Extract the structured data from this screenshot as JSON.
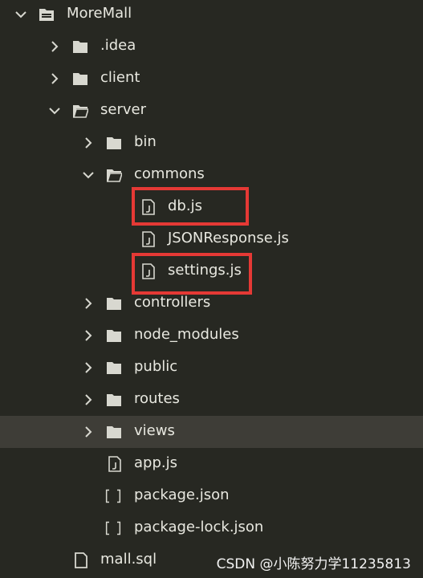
{
  "tree": {
    "root": {
      "label": "MoreMall",
      "icon": "open-folder-icon",
      "expanded": true
    },
    "items": [
      {
        "label": ".idea",
        "type": "folder",
        "expanded": false
      },
      {
        "label": "client",
        "type": "folder",
        "expanded": false
      },
      {
        "label": "server",
        "type": "folder",
        "expanded": true
      },
      {
        "label": "bin",
        "type": "folder",
        "expanded": false
      },
      {
        "label": "commons",
        "type": "folder",
        "expanded": true
      },
      {
        "label": "db.js",
        "type": "js-file",
        "highlighted": true
      },
      {
        "label": "JSONResponse.js",
        "type": "js-file"
      },
      {
        "label": "settings.js",
        "type": "js-file",
        "highlighted": true
      },
      {
        "label": "controllers",
        "type": "folder",
        "expanded": false
      },
      {
        "label": "node_modules",
        "type": "folder",
        "expanded": false
      },
      {
        "label": "public",
        "type": "folder",
        "expanded": false
      },
      {
        "label": "routes",
        "type": "folder",
        "expanded": false
      },
      {
        "label": "views",
        "type": "folder",
        "expanded": false,
        "selected": true
      },
      {
        "label": "app.js",
        "type": "js-file"
      },
      {
        "label": "package.json",
        "type": "json-file"
      },
      {
        "label": "package-lock.json",
        "type": "json-file"
      },
      {
        "label": "mall.sql",
        "type": "file"
      }
    ]
  },
  "watermark": "CSDN @小陈努力学11235813",
  "colors": {
    "background": "#272822",
    "selection": "#3e3d37",
    "text": "#e8e8e0",
    "highlight_border": "#e53935"
  }
}
